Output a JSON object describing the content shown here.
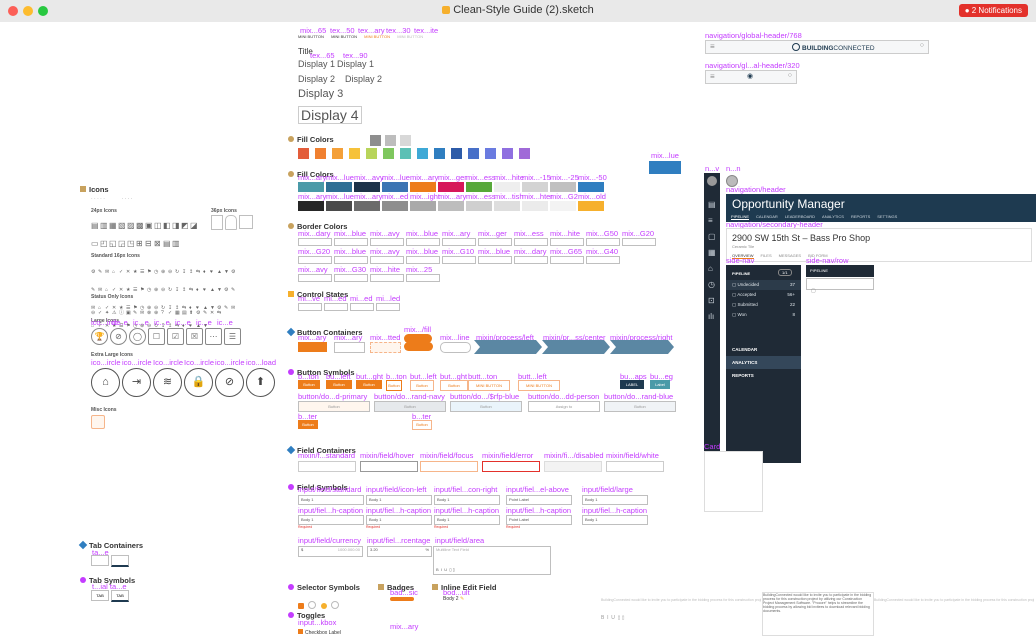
{
  "window": {
    "title": "Clean-Style Guide (2).sketch",
    "notifications": "2 Notifications"
  },
  "colors": {
    "magenta": "#c43cff",
    "dark_nav": "#1e3a50"
  },
  "top_labels": [
    "mix...65",
    "tex...50",
    "tex...ary",
    "tex...30",
    "tex...ite"
  ],
  "top_buttons": [
    "MINI BUTTON",
    "MINI BUTTON",
    "MINI BUTTON",
    "MINI BUTTON"
  ],
  "typo": {
    "label_a": "tex...65",
    "label_b": "tex...90",
    "display1": "Display 1",
    "display2": "Display 2",
    "display3": "Display 3",
    "display4": "Display 4",
    "title": "Title"
  },
  "sections": {
    "icons": "Icons",
    "fill_colors": "Fill Colors",
    "fill_colors2": "Fill Colors",
    "border_colors": "Border Colors",
    "control_states": "Control States",
    "button_containers": "Button Containers",
    "button_symbols": "Button Symbols",
    "field_containers": "Field Containers",
    "field_symbols": "Field Symbols",
    "tab_containers": "Tab Containers",
    "tab_symbols": "Tab Symbols",
    "selector_symbols": "Selector Symbols",
    "badges": "Badges",
    "inline_edit": "Inline Edit Field",
    "toggles": "Toggles"
  },
  "icons_groups": [
    "24px Icons",
    "36px Icons",
    "Standard 16px Icons",
    "Status Only Icons",
    "Large Icons",
    "Extra Large Icons",
    "Misc Icons"
  ],
  "large_icon_labels": [
    "ico...ircle",
    "ic...e",
    "ic...e",
    "ic...e",
    "ic...e",
    "ic...e",
    "ic...e"
  ],
  "xl_icon_labels": [
    "ico...ircle",
    "ico...ircle",
    "Ico...ircle",
    "Ico...ircle",
    "ico...ircle",
    "ico...load"
  ],
  "fill_labels": [
    "mix...ary",
    "mix...lue",
    "mix...avy",
    "mix...lue",
    "mix...ary",
    "mix...ger",
    "mix...ess",
    "mix...hite",
    "mix...-15",
    "mix...-25",
    "mix...-50"
  ],
  "fill_labels_extra": "mix...lue",
  "fill_row2_labels": [
    "mix...ary",
    "mix...lue",
    "mix...ary",
    "mix...ed",
    "mix...ight",
    "mix...ary",
    "mix...ess",
    "mix...tish",
    "mix...hter",
    "mix...G2",
    "mix...old"
  ],
  "fill_colors_row": [
    "#e35d3b",
    "#f08030",
    "#f4a038",
    "#f6c23a",
    "#b8d45a",
    "#7ec75e",
    "#5bc0b5",
    "#3ea9d6",
    "#2f7ec0",
    "#2d5ba8",
    "#4870c8",
    "#6a7be0",
    "#8f6fe0",
    "#a06ad8"
  ],
  "fill_colors_a": [
    "#4a9aa8",
    "#2e6f95",
    "#1d3349",
    "#3b74b3",
    "#ed7c1a",
    "#d6185a",
    "#57a839",
    "#eeeeee",
    "#d3d3d3",
    "#c0c0c0",
    "#2f7ec0"
  ],
  "fill_colors_b": [
    "#262626",
    "#4a4a4a",
    "#6b6b6b",
    "#8e8e8e",
    "#a9a9a9",
    "#bdbdbd",
    "#cfcfcf",
    "#dedede",
    "#ebebeb",
    "#f3f3f3",
    "#f6b02d"
  ],
  "border_labels_a": [
    "mix...dary",
    "mix...blue",
    "mix...avy",
    "mix...blue",
    "mix...ary",
    "mix...ger",
    "mix...ess",
    "mix...hite",
    "mix...G50",
    "mix...G20"
  ],
  "border_labels_b": [
    "mix...G20",
    "mix...blue",
    "mix...avy",
    "mix...blue",
    "mix...G10",
    "mix...blue",
    "mix...dary",
    "mix...G65",
    "mix...G40"
  ],
  "border_labels_c": [
    "mix...avy",
    "mix...G30",
    "mix...hite",
    "mix...25"
  ],
  "control_labels": [
    "mi...ve",
    "mi...ed",
    "mi...ed",
    "mi...led"
  ],
  "button_containers_labels": [
    "mix...ary",
    "mix...ary",
    "mix...tted",
    "mix.../fill",
    "mix...line",
    "mixin/process/left",
    "mixin/pr...ss/center",
    "mixin/process/right"
  ],
  "button_symbols_labels": [
    "b...ton",
    "bu...left",
    "but...ght",
    "b...ton",
    "but...left",
    "but...ght",
    "butt...ton",
    "butt...left",
    "bu...aps",
    "bu...eg"
  ],
  "buttons": [
    "Button",
    "Button",
    "Button",
    "Button",
    "Button",
    "Button",
    "MINI BUTTON",
    "MINI BUTTON",
    "LABEL",
    "Label"
  ],
  "button_row2_labels": [
    "button/do...d-primary",
    "button/do...rand-navy",
    "button/do.../$rfp-blue",
    "button/do...dd-person",
    "button/do...rand-blue"
  ],
  "button_row2_values": [
    "Button",
    "Button",
    "Button",
    "Assign to",
    "Button"
  ],
  "button_misc": [
    "b...ter",
    "b...ter",
    "Button",
    "Button"
  ],
  "field_containers_labels": [
    "mixin/f...standard",
    "mixin/field/hover",
    "mixin/field/focus",
    "mixin/field/error",
    "mixin/fi.../disabled",
    "mixin/field/white"
  ],
  "field_symbols_labels": [
    "input/field/standard",
    "input/field/icon-left",
    "input/fiel...con-right",
    "input/fiel...el-above",
    "input/field/large"
  ],
  "field_symbols_labels2": [
    "input/fiel...h-caption",
    "input/fiel...h-caption",
    "input/fiel...h-caption",
    "input/fiel...h-caption",
    "input/fiel...h-caption"
  ],
  "field_values": [
    "Body 1",
    "Body 1",
    "Body 1",
    "Point Label",
    "Body 1"
  ],
  "field_captions": [
    "Required",
    "Required",
    "Required",
    "Required"
  ],
  "field_misc": [
    "input/field/currency",
    "input/fiel...rcentage",
    "input/field/area"
  ],
  "field_misc_values": [
    "$",
    "1000.000.00",
    "3.20",
    "%",
    "Multiline Text Field"
  ],
  "tabs": {
    "label": "ta...e",
    "labels2": "t...ial ta...e",
    "tab1": "TAB",
    "tab2": "TAB"
  },
  "selector": {
    "label": "Selector Symbols",
    "badge_label": "bad...sic",
    "inline_label": "Body 2",
    "toggle_label": "input...kbox",
    "toggle_value": "Checkbox Label",
    "mix": "mix...ary"
  },
  "nav": {
    "global_label": "navigation/global-header/768",
    "small_label": "navigation/gl...al-header/320",
    "brand_bold": "BUILDING",
    "brand_light": "CONNECTED",
    "side_labels": [
      "n...v",
      "n...n"
    ],
    "header_label": "navigation/header",
    "opp_title": "Opportunity Manager",
    "opp_tabs": [
      "PIPELINE",
      "CALENDAR",
      "LEADERBOARD",
      "ANALYTICS",
      "REPORTS",
      "SETTINGS"
    ],
    "secondary_label": "navigation/secondary-header",
    "address": "2900 SW 15th St – Bass Pro Shop",
    "subaddr": "Ceramic Tile",
    "sec_tabs": [
      "OVERVIEW",
      "FILES",
      "MESSAGES",
      "BID FORM"
    ],
    "side_nav_label": "side-nav",
    "side_nav_row": "side-nav/row",
    "pipeline_items": [
      [
        "Undecided",
        "37"
      ],
      [
        "Accepted",
        "56+"
      ],
      [
        "Submitted",
        "22"
      ],
      [
        "Won",
        "8"
      ]
    ],
    "pipeline_head": "PIPELINE",
    "pipeline_badge": "1/1",
    "menu": [
      "CALENDAR",
      "ANALYTICS",
      "REPORTS"
    ],
    "row_item": "PIPELINE",
    "card_label": "Card"
  },
  "footer_text": "BuildingConnected would like to invite you to participate in the bidding process for this construction project by utilizing our Construction Project Management Software. \"Procore\" helps to streamline the bidding process by allowing bid invitees to download relevant bidding documents."
}
